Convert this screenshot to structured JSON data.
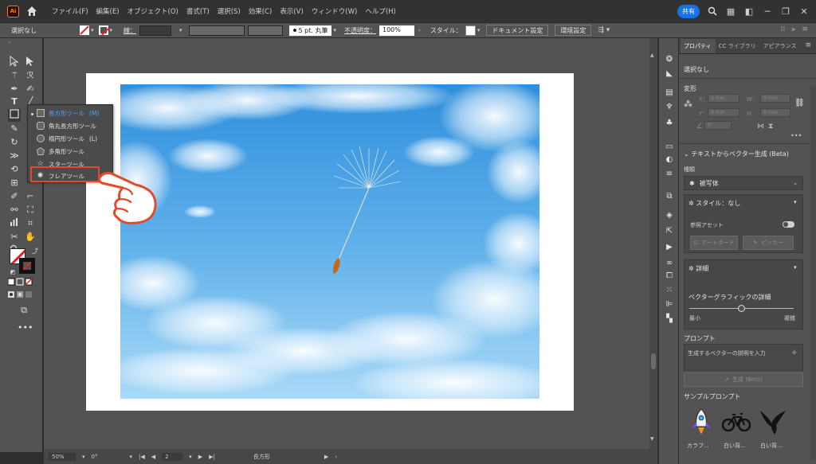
{
  "app": {
    "logo_text": "Ai",
    "share_label": "共有"
  },
  "menus": [
    "ファイル(F)",
    "編集(E)",
    "オブジェクト(O)",
    "書式(T)",
    "選択(S)",
    "効果(C)",
    "表示(V)",
    "ウィンドウ(W)",
    "ヘルプ(H)"
  ],
  "controlbar": {
    "selection": "選択なし",
    "stroke_label": "線：",
    "brush_value": "5 pt. 丸筆",
    "opacity_label": "不透明度：",
    "opacity_value": "100%",
    "style_label": "スタイル：",
    "document_setup": "ドキュメント設定",
    "preferences": "環境設定"
  },
  "flyout": {
    "items": [
      {
        "label": "長方形ツール",
        "key": "(M)"
      },
      {
        "label": "角丸長方形ツール",
        "key": ""
      },
      {
        "label": "楕円形ツール",
        "key": "(L)"
      },
      {
        "label": "多角形ツール",
        "key": ""
      },
      {
        "label": "スターツール",
        "key": ""
      },
      {
        "label": "フレアツール",
        "key": ""
      }
    ]
  },
  "statusbar": {
    "zoom": "50%",
    "angle": "0°",
    "page": "2",
    "tool_name": "長方形"
  },
  "panel": {
    "tabs": [
      "プロパティ",
      "CC ライブラリ",
      "アピアランス"
    ],
    "selection": "選択なし",
    "transform_title": "変形",
    "x_label": "X：",
    "y_label": "Y：",
    "w_label": "W：",
    "h_label": "H：",
    "x_value": "0 mm",
    "y_value": "0 mm",
    "w_value": "0 mm",
    "h_value": "0 mm",
    "angle_value": "0°",
    "text_to_vector_title": "テキストからベクター生成 (Beta)",
    "type_label": "種類",
    "type_value": "被写体",
    "style_value": "スタイル：なし",
    "reference_asset": "参照アセット",
    "artboard_button": "アートボード",
    "picker_button": "ピッカー",
    "detail_section": "詳細",
    "vector_detail": "ベクターグラフィックの詳細",
    "min_label": "最小",
    "max_label": "複雑",
    "prompt_title": "プロンプト",
    "prompt_placeholder": "生成するベクターの説明を入力",
    "generate_button": "生成 (Beta)",
    "sample_title": "サンプルプロンプト",
    "samples": [
      "カラフ...",
      "白い背...",
      "白い背..."
    ]
  }
}
